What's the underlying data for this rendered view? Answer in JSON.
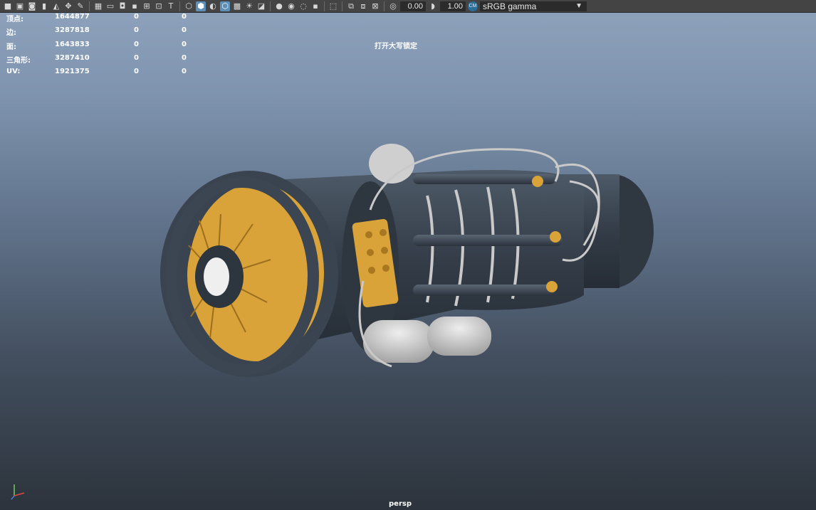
{
  "toolbar": {
    "exposure_value": "0.00",
    "gamma_value": "1.00",
    "color_management_icon": "cm-icon",
    "view_transform": "sRGB gamma",
    "icons": [
      "camera-icon",
      "camera-attr-icon",
      "bookmark-icon",
      "snapshot-icon",
      "image-plane-icon",
      "grease-pencil-icon",
      "grid-icon",
      "film-gate-icon",
      "resolution-gate-icon",
      "gate-mask-icon",
      "field-chart-icon",
      "safe-action-icon",
      "safe-title-icon",
      "wireframe-icon",
      "smooth-shade-icon",
      "default-material-icon",
      "textured-icon",
      "xray-icon",
      "use-lights-icon",
      "shadows-icon",
      "screen-ao-icon",
      "motion-blur-icon",
      "anti-alias-icon",
      "depth-of-field-icon",
      "isolate-select-icon",
      "xray-joints-icon",
      "xray-active-icon",
      "backface-icon",
      "hud-icon",
      "exposure-icon",
      "gamma-icon"
    ]
  },
  "hud": {
    "rows": [
      {
        "label": "顶点:",
        "v1": "1644877",
        "v2": "0",
        "v3": "0"
      },
      {
        "label": "边:",
        "v1": "3287818",
        "v2": "0",
        "v3": "0"
      },
      {
        "label": "面:",
        "v1": "1643833",
        "v2": "0",
        "v3": "0"
      },
      {
        "label": "三角形:",
        "v1": "3287410",
        "v2": "0",
        "v3": "0"
      },
      {
        "label": "UV:",
        "v1": "1921375",
        "v2": "0",
        "v3": "0"
      }
    ]
  },
  "viewport": {
    "caps_lock_message": "打开大写锁定",
    "camera_name": "persp",
    "colors": {
      "bg_top": "#8fa3bd",
      "bg_bottom": "#2c333c",
      "engine_body": "#3a4350",
      "fan_blades": "#d9a33a",
      "pipes": "#c8c8c8"
    }
  }
}
